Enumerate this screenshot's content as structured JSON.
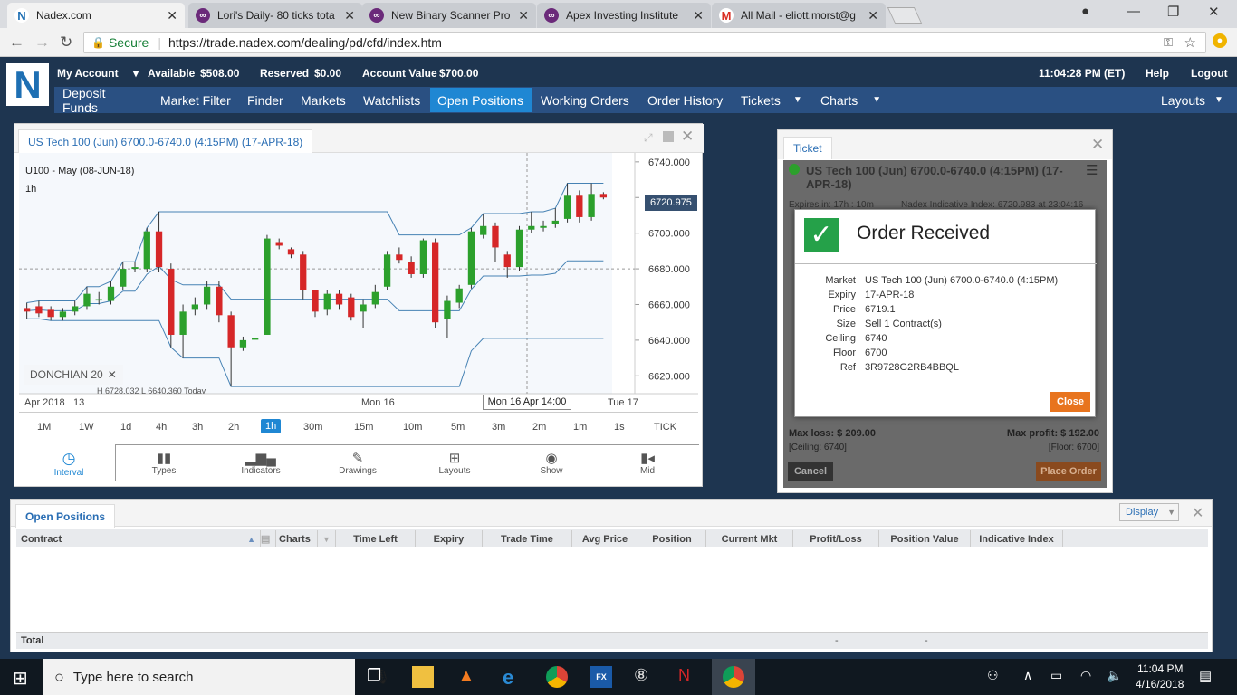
{
  "browser": {
    "tabs": [
      {
        "title": "Nadex.com",
        "icon": "nadex-favicon",
        "active": true
      },
      {
        "title": "Lori's Daily- 80 ticks tota",
        "icon": "eye-favicon"
      },
      {
        "title": "New Binary Scanner Pro",
        "icon": "eye-favicon"
      },
      {
        "title": "Apex Investing Institute",
        "icon": "eye-favicon"
      },
      {
        "title": "All Mail - eliott.morst@g",
        "icon": "gmail-favicon"
      }
    ],
    "secure_label": "Secure",
    "url": "https://trade.nadex.com/dealing/pd/cfd/index.htm"
  },
  "header": {
    "my_account": "My Account",
    "available_label": "Available",
    "available_value": "$508.00",
    "reserved_label": "Reserved",
    "reserved_value": "$0.00",
    "account_value_label": "Account Value",
    "account_value": "$700.00",
    "clock": "11:04:28 PM (ET)",
    "help": "Help",
    "logout": "Logout"
  },
  "nav": {
    "items": [
      "Deposit Funds",
      "Market Filter",
      "Finder",
      "Markets",
      "Watchlists",
      "Open Positions",
      "Working Orders",
      "Order History",
      "Tickets",
      "Charts"
    ],
    "active": "Open Positions",
    "layouts": "Layouts"
  },
  "chart_panel": {
    "tab_title": "US Tech 100 (Jun) 6700.0-6740.0 (4:15PM) (17-APR-18)",
    "instrument": "U100 - May (08-JUN-18)",
    "timeframe": "1h",
    "indicator_label": "DONCHIAN  20",
    "indicator_sub": "H 6728.032    L 6640.360    Today",
    "current_price_label": "6720.975",
    "crosshair_label": "Mon 16 Apr 14:00",
    "x_labels": [
      "Apr 2018",
      "13",
      "Mon 16",
      "Tue 17"
    ],
    "intervals": [
      "1M",
      "1W",
      "1d",
      "4h",
      "3h",
      "2h",
      "1h",
      "30m",
      "15m",
      "10m",
      "5m",
      "3m",
      "2m",
      "1m",
      "1s",
      "TICK"
    ],
    "selected_interval": "1h",
    "tools": [
      "Interval",
      "Types",
      "Indicators",
      "Drawings",
      "Layouts",
      "Show",
      "Mid"
    ]
  },
  "chart_data": {
    "type": "candlestick",
    "title": "U100 - May (08-JUN-18)",
    "y_ticks": [
      "6740.000",
      "6720.000",
      "6700.000",
      "6680.000",
      "6660.000",
      "6640.000",
      "6620.000"
    ],
    "ylim": [
      6610,
      6745
    ],
    "last_price": 6720.975,
    "candles": [
      {
        "o": 6658,
        "c": 6656,
        "h": 6661,
        "l": 6652
      },
      {
        "o": 6659,
        "c": 6655,
        "h": 6662,
        "l": 6653
      },
      {
        "o": 6657,
        "c": 6653,
        "h": 6659,
        "l": 6651
      },
      {
        "o": 6653,
        "c": 6656,
        "h": 6658,
        "l": 6651
      },
      {
        "o": 6656,
        "c": 6659,
        "h": 6662,
        "l": 6654
      },
      {
        "o": 6659,
        "c": 6666,
        "h": 6670,
        "l": 6657
      },
      {
        "o": 6663,
        "c": 6663,
        "h": 6667,
        "l": 6660
      },
      {
        "o": 6662,
        "c": 6670,
        "h": 6673,
        "l": 6660
      },
      {
        "o": 6670,
        "c": 6680,
        "h": 6684,
        "l": 6668
      },
      {
        "o": 6680,
        "c": 6681,
        "h": 6684,
        "l": 6678
      },
      {
        "o": 6680,
        "c": 6701,
        "h": 6703,
        "l": 6678
      },
      {
        "o": 6701,
        "c": 6681,
        "h": 6712,
        "l": 6678
      },
      {
        "o": 6680,
        "c": 6643,
        "h": 6683,
        "l": 6636
      },
      {
        "o": 6643,
        "c": 6656,
        "h": 6660,
        "l": 6630
      },
      {
        "o": 6657,
        "c": 6660,
        "h": 6664,
        "l": 6654
      },
      {
        "o": 6660,
        "c": 6670,
        "h": 6673,
        "l": 6657
      },
      {
        "o": 6670,
        "c": 6654,
        "h": 6673,
        "l": 6650
      },
      {
        "o": 6654,
        "c": 6636,
        "h": 6656,
        "l": 6614
      },
      {
        "o": 6636,
        "c": 6640,
        "h": 6642,
        "l": 6634
      },
      {
        "o": 6641,
        "c": 6641,
        "h": 6641,
        "l": 6641
      },
      {
        "o": 6643,
        "c": 6697,
        "h": 6699,
        "l": 6643
      },
      {
        "o": 6695,
        "c": 6693,
        "h": 6697,
        "l": 6691
      },
      {
        "o": 6691,
        "c": 6688,
        "h": 6692,
        "l": 6686
      },
      {
        "o": 6688,
        "c": 6668,
        "h": 6690,
        "l": 6663
      },
      {
        "o": 6668,
        "c": 6656,
        "h": 6668,
        "l": 6653
      },
      {
        "o": 6657,
        "c": 6666,
        "h": 6668,
        "l": 6654
      },
      {
        "o": 6666,
        "c": 6660,
        "h": 6668,
        "l": 6657
      },
      {
        "o": 6664,
        "c": 6653,
        "h": 6666,
        "l": 6651
      },
      {
        "o": 6656,
        "c": 6660,
        "h": 6663,
        "l": 6647
      },
      {
        "o": 6660,
        "c": 6667,
        "h": 6671,
        "l": 6658
      },
      {
        "o": 6670,
        "c": 6688,
        "h": 6690,
        "l": 6668
      },
      {
        "o": 6688,
        "c": 6685,
        "h": 6692,
        "l": 6683
      },
      {
        "o": 6684,
        "c": 6677,
        "h": 6687,
        "l": 6675
      },
      {
        "o": 6677,
        "c": 6696,
        "h": 6697,
        "l": 6675
      },
      {
        "o": 6695,
        "c": 6650,
        "h": 6697,
        "l": 6647
      },
      {
        "o": 6652,
        "c": 6662,
        "h": 6665,
        "l": 6641
      },
      {
        "o": 6661,
        "c": 6669,
        "h": 6671,
        "l": 6658
      },
      {
        "o": 6671,
        "c": 6701,
        "h": 6703,
        "l": 6669
      },
      {
        "o": 6699,
        "c": 6704,
        "h": 6711,
        "l": 6697
      },
      {
        "o": 6704,
        "c": 6692,
        "h": 6706,
        "l": 6684
      },
      {
        "o": 6688,
        "c": 6681,
        "h": 6690,
        "l": 6675
      },
      {
        "o": 6681,
        "c": 6702,
        "h": 6704,
        "l": 6679
      },
      {
        "o": 6702,
        "c": 6704,
        "h": 6712,
        "l": 6700
      },
      {
        "o": 6703,
        "c": 6704,
        "h": 6707,
        "l": 6701
      },
      {
        "o": 6705,
        "c": 6707,
        "h": 6714,
        "l": 6703
      },
      {
        "o": 6708,
        "c": 6721,
        "h": 6728,
        "l": 6706
      },
      {
        "o": 6721,
        "c": 6709,
        "h": 6724,
        "l": 6706
      },
      {
        "o": 6709,
        "c": 6722,
        "h": 6728,
        "l": 6707
      },
      {
        "o": 6722,
        "c": 6720,
        "h": 6723,
        "l": 6719
      }
    ]
  },
  "ticket": {
    "tab": "Ticket",
    "title": "US Tech 100 (Jun) 6700.0-6740.0 (4:15PM) (17-APR-18)",
    "expires": "Expires in: 17h : 10m",
    "indicative": "Nadex Indicative Index: 6720.983 at 23:04:16",
    "max_loss": "Max loss:  $ 209.00",
    "max_profit": "Max profit:  $ 192.00",
    "ceiling_note": "[Ceiling: 6740]",
    "floor_note": "[Floor: 6700]",
    "cancel": "Cancel",
    "place_order": "Place Order"
  },
  "dialog": {
    "title": "Order Received",
    "rows": [
      {
        "k": "Market",
        "v": "US Tech 100 (Jun) 6700.0-6740.0 (4:15PM)"
      },
      {
        "k": "Expiry",
        "v": "17-APR-18"
      },
      {
        "k": "Price",
        "v": "6719.1"
      },
      {
        "k": "Size",
        "v": "Sell 1 Contract(s)"
      },
      {
        "k": "Ceiling",
        "v": "6740"
      },
      {
        "k": "Floor",
        "v": "6700"
      },
      {
        "k": "Ref",
        "v": "3R9728G2RB4BBQL"
      }
    ],
    "close": "Close"
  },
  "positions": {
    "tab": "Open Positions",
    "display": "Display",
    "columns": [
      "Contract",
      "Charts",
      "Time Left",
      "Expiry",
      "Trade Time",
      "Avg Price",
      "Position",
      "Current Mkt",
      "Profit/Loss",
      "Position Value",
      "Indicative Index"
    ],
    "total_label": "Total",
    "total_pl": "-",
    "total_pv": "-"
  },
  "taskbar": {
    "search_placeholder": "Type here to search",
    "time": "11:04 PM",
    "date": "4/16/2018"
  },
  "colors": {
    "up": "#2ca02c",
    "down": "#d62728",
    "donchian": "#4682b4",
    "nav_active": "#1f87d3",
    "close_button": "#e8741e"
  }
}
